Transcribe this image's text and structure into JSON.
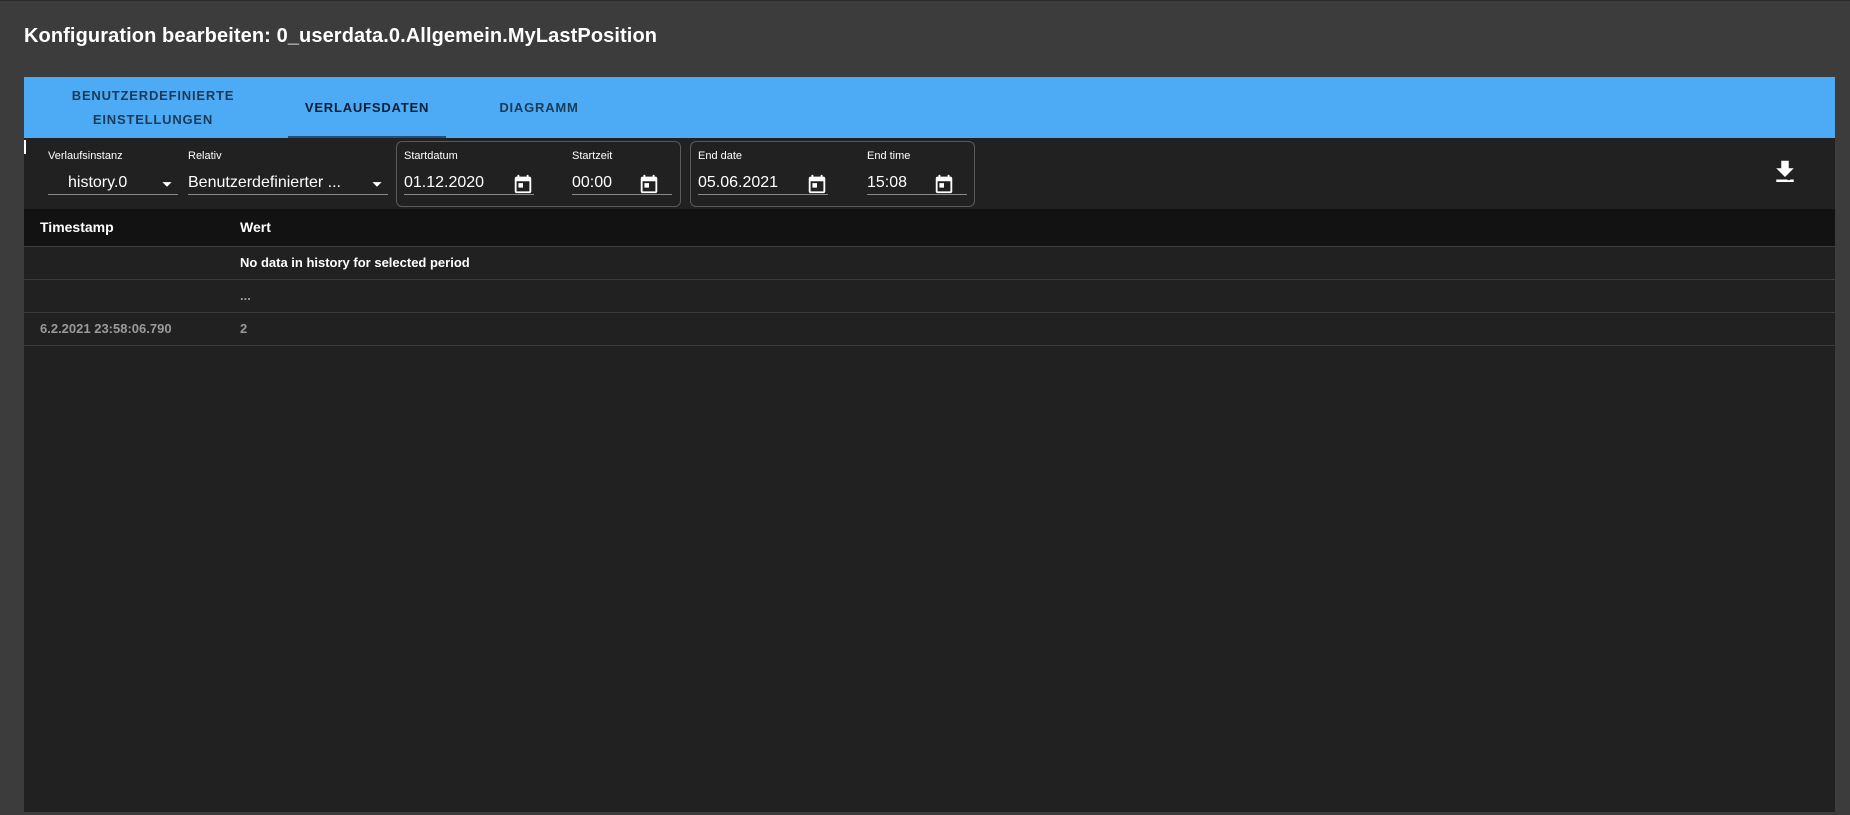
{
  "dialog": {
    "title": "Konfiguration bearbeiten: 0_userdata.0.Allgemein.MyLastPosition"
  },
  "tabs": [
    {
      "label": "BENUTZERDEFINIERTE EINSTELLUNGEN",
      "active": false
    },
    {
      "label": "VERLAUFSDATEN",
      "active": true
    },
    {
      "label": "DIAGRAMM",
      "active": false
    }
  ],
  "filters": {
    "instance": {
      "label": "Verlaufsinstanz",
      "value": "history.0"
    },
    "relative": {
      "label": "Relativ",
      "value": "Benutzerdefinierter ..."
    },
    "start_date": {
      "label": "Startdatum",
      "value": "01.12.2020"
    },
    "start_time": {
      "label": "Startzeit",
      "value": "00:00"
    },
    "end_date": {
      "label": "End date",
      "value": "05.06.2021"
    },
    "end_time": {
      "label": "End time",
      "value": "15:08"
    }
  },
  "table": {
    "headers": [
      "Timestamp",
      "Wert"
    ],
    "rows": [
      {
        "timestamp": "",
        "value": "No data in history for selected period"
      },
      {
        "timestamp": "",
        "value": "..."
      },
      {
        "timestamp": "6.2.2021 23:58:06.790",
        "value": "2"
      }
    ]
  },
  "colors": {
    "tab_bar": "#4dabf5",
    "dialog_bg": "#3c3c3c",
    "panel_bg": "#212121"
  },
  "icons": {
    "calendar": "calendar-icon",
    "dropdown": "arrow-drop-down-icon",
    "download": "download-icon"
  }
}
